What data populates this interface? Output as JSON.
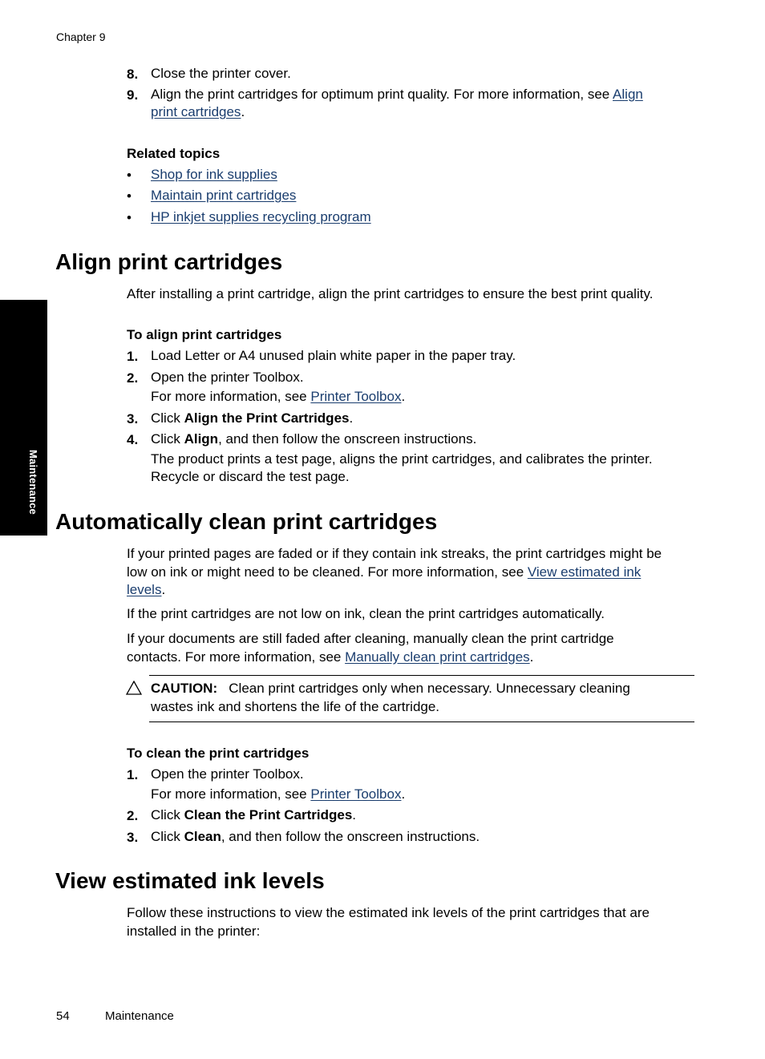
{
  "header": {
    "chapter": "Chapter 9"
  },
  "side_tab": {
    "label": "Maintenance"
  },
  "intro_steps": [
    {
      "num": "8.",
      "text": "Close the printer cover."
    },
    {
      "num": "9.",
      "text": "Align the print cartridges for optimum print quality. For more information, see ",
      "link": "Align",
      "link2": "print cartridges",
      "after": "."
    }
  ],
  "related": {
    "heading": "Related topics",
    "bullet": "•",
    "items": [
      "Shop for ink supplies",
      "Maintain print cartridges",
      "HP inkjet supplies recycling program"
    ]
  },
  "align": {
    "title": "Align print cartridges",
    "intro": "After installing a print cartridge, align the print cartridges to ensure the best print quality.",
    "subheading": "To align print cartridges",
    "steps": [
      {
        "num": "1.",
        "text": "Load Letter or A4 unused plain white paper in the paper tray."
      },
      {
        "num": "2.",
        "text": "Open the printer Toolbox.",
        "more_prefix": "For more information, see ",
        "more_link": "Printer Toolbox",
        "more_after": "."
      },
      {
        "num": "3.",
        "pre": "Click ",
        "bold": "Align the Print Cartridges",
        "post": "."
      },
      {
        "num": "4.",
        "pre": "Click ",
        "bold": "Align",
        "post": ", and then follow the onscreen instructions.",
        "note_line1": "The product prints a test page, aligns the print cartridges, and calibrates the printer.",
        "note_line2": "Recycle or discard the test page."
      }
    ]
  },
  "autoclean": {
    "title": "Automatically clean print cartridges",
    "p1_line1": "If your printed pages are faded or if they contain ink streaks, the print cartridges might be",
    "p1_line2_pre": "low on ink or might need to be cleaned. For more information, see ",
    "p1_link_a": "View estimated ink",
    "p1_link_b": "levels",
    "p1_after": ".",
    "p2": "If the print cartridges are not low on ink, clean the print cartridges automatically.",
    "p3_line1": "If your documents are still faded after cleaning, manually clean the print cartridge",
    "p3_line2_pre": "contacts. For more information, see ",
    "p3_link": "Manually clean print cartridges",
    "p3_after": ".",
    "caution": {
      "icon": "warning-triangle-icon",
      "label": "CAUTION:",
      "line1": "Clean print cartridges only when necessary. Unnecessary cleaning",
      "line2": "wastes ink and shortens the life of the cartridge."
    },
    "subheading": "To clean the print cartridges",
    "steps": [
      {
        "num": "1.",
        "text": "Open the printer Toolbox.",
        "more_prefix": "For more information, see ",
        "more_link": "Printer Toolbox",
        "more_after": "."
      },
      {
        "num": "2.",
        "pre": "Click ",
        "bold": "Clean the Print Cartridges",
        "post": "."
      },
      {
        "num": "3.",
        "pre": "Click ",
        "bold": "Clean",
        "post": ", and then follow the onscreen instructions."
      }
    ]
  },
  "inklevels": {
    "title": "View estimated ink levels",
    "line1": "Follow these instructions to view the estimated ink levels of the print cartridges that are",
    "line2": "installed in the printer:"
  },
  "footer": {
    "page_number": "54",
    "section": "Maintenance"
  },
  "colors": {
    "link": "#1a3d6e",
    "tab": "#000000"
  }
}
